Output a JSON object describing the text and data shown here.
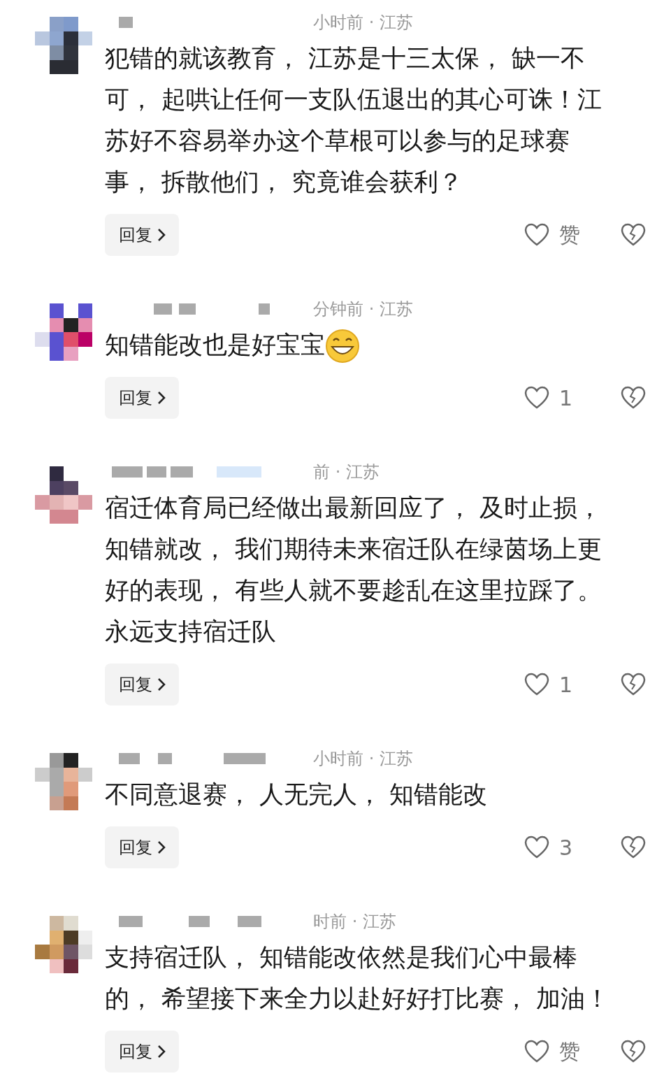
{
  "comments": [
    {
      "meta": "小时前 · 江苏",
      "text": "犯错的就该教育， 江苏是十三太保， 缺一不可， 起哄让任何一支队伍退出的其心可诛！江苏好不容易举办这个草根可以参与的足球赛事， 拆散他们， 究竟谁会获利？",
      "emoji": false,
      "reply": "回复",
      "likes": "赞"
    },
    {
      "meta": "分钟前 · 江苏",
      "text": "知错能改也是好宝宝",
      "emoji": true,
      "reply": "回复",
      "likes": "1"
    },
    {
      "meta": "前 · 江苏",
      "text": "宿迁体育局已经做出最新回应了， 及时止损，知错就改， 我们期待未来宿迁队在绿茵场上更好的表现， 有些人就不要趁乱在这里拉踩了。永远支持宿迁队",
      "emoji": false,
      "reply": "回复",
      "likes": "1"
    },
    {
      "meta": "小时前 · 江苏",
      "text": "不同意退赛， 人无完人， 知错能改",
      "emoji": false,
      "reply": "回复",
      "likes": "3"
    },
    {
      "meta": "时前 · 江苏",
      "text": "支持宿迁队， 知错能改依然是我们心中最棒的， 希望接下来全力以赴好好打比赛， 加油！",
      "emoji": false,
      "reply": "回复",
      "likes": "赞"
    }
  ]
}
